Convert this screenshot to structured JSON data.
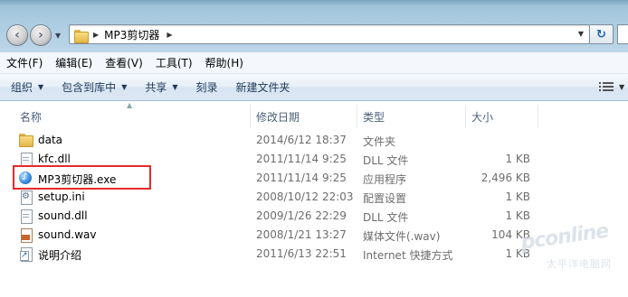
{
  "address_bar": {
    "path_segment": "MP3剪切器"
  },
  "menu": {
    "items": [
      "文件(F)",
      "编辑(E)",
      "查看(V)",
      "工具(T)",
      "帮助(H)"
    ]
  },
  "command_bar": {
    "organize": "组织",
    "include_in_library": "包含到库中",
    "share": "共享",
    "burn": "刻录",
    "new_folder": "新建文件夹"
  },
  "columns": {
    "name": "名称",
    "date_modified": "修改日期",
    "type": "类型",
    "size": "大小"
  },
  "files": [
    {
      "name": "data",
      "date": "2014/6/12 18:37",
      "type": "文件夹",
      "size": "",
      "icon": "folder-icon"
    },
    {
      "name": "kfc.dll",
      "date": "2011/11/14 9:25",
      "type": "DLL 文件",
      "size": "1 KB",
      "icon": "dll-file-icon"
    },
    {
      "name": "MP3剪切器.exe",
      "date": "2011/11/14 9:25",
      "type": "应用程序",
      "size": "2,496 KB",
      "icon": "application-icon"
    },
    {
      "name": "setup.ini",
      "date": "2008/10/12 22:03",
      "type": "配置设置",
      "size": "1 KB",
      "icon": "settings-file-icon"
    },
    {
      "name": "sound.dll",
      "date": "2009/1/26 22:29",
      "type": "DLL 文件",
      "size": "1 KB",
      "icon": "dll-file-icon"
    },
    {
      "name": "sound.wav",
      "date": "2008/1/21 13:27",
      "type": "媒体文件(.wav)",
      "size": "104 KB",
      "icon": "audio-file-icon"
    },
    {
      "name": "说明介绍",
      "date": "2011/6/13 22:51",
      "type": "Internet 快捷方式",
      "size": "1 KB",
      "icon": "shortcut-icon"
    }
  ],
  "watermark": {
    "logo": "pconline",
    "sub": "太平洋电脑网"
  },
  "colors": {
    "highlight_box": "#e52a2a",
    "command_text": "#1e395b"
  }
}
